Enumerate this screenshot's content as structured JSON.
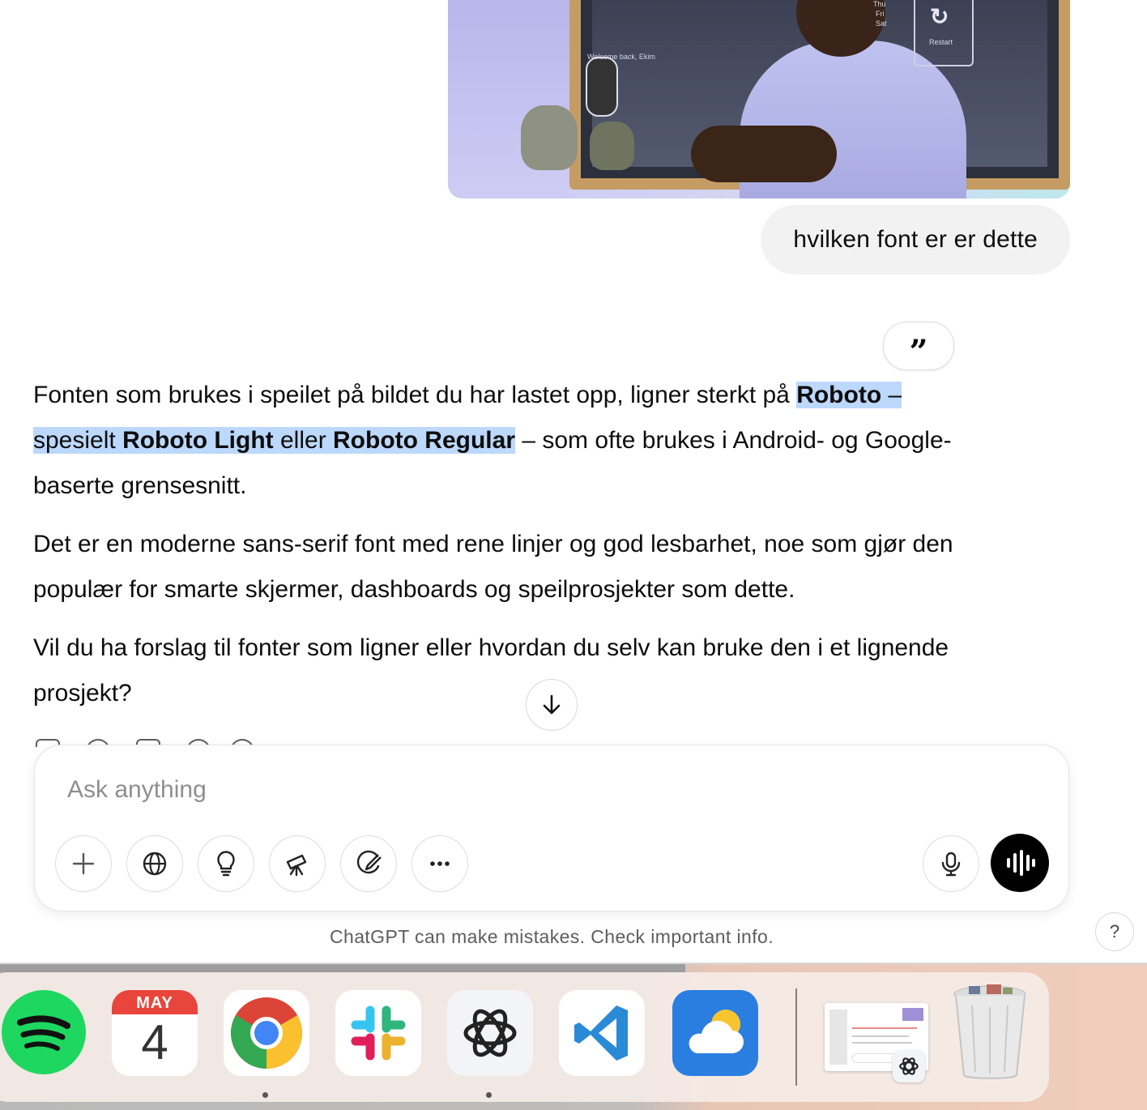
{
  "conversation": {
    "user_message": "hvilken font er er dette",
    "quote_icon": "quote-icon",
    "answer": {
      "p1": {
        "t1": "Fonten som brukes i speilet på bildet du har lastet opp, ligner sterkt på ",
        "t2": "R",
        "b1": "oboto",
        "t3": " –",
        "t4": "spesielt ",
        "b2": "Roboto Light",
        "t5": " eller ",
        "b3": "Roboto Regular",
        "t6": " – som ofte brukes i Android- og Google-",
        "t7": "baserte grensesnitt."
      },
      "p2": "Det er en moderne sans-serif font med rene linjer og god lesbarhet, noe som gjør den populær for smarte skjermer, dashboards og speilprosjekter som dette.",
      "p3": "Vil du ha forslag til fonter som ligner eller hvordan du selv kan bruke den i et lignende prosjekt?"
    }
  },
  "composer": {
    "placeholder": "Ask anything",
    "tools": [
      "plus-icon",
      "globe-icon",
      "lightbulb-icon",
      "telescope-icon",
      "paintbrush-icon",
      "more-icon"
    ],
    "mic_icon": "microphone-icon",
    "voice_icon": "voice-mode-icon"
  },
  "footer": {
    "disclaimer": "ChatGPT can make mistakes. Check important info.",
    "help": "?"
  },
  "photo": {
    "panel_labels": [
      "Thu",
      "Fri",
      "Sat"
    ],
    "restart_label": "Restart",
    "welcome_text": "Welcome back, Ekim"
  },
  "dock": {
    "calendar_month": "MAY",
    "calendar_day": "4",
    "apps": [
      "Spotify",
      "Calendar",
      "Google Chrome",
      "Slack",
      "ChatGPT",
      "Visual Studio Code",
      "Weather",
      "Window thumbnail",
      "Trash"
    ]
  },
  "colors": {
    "highlight": "#bcd8fb",
    "bubble": "#f2f2f2",
    "spotify": "#1ed760",
    "vscode": "#2b8ad6",
    "weather": "#2a7ee0"
  }
}
